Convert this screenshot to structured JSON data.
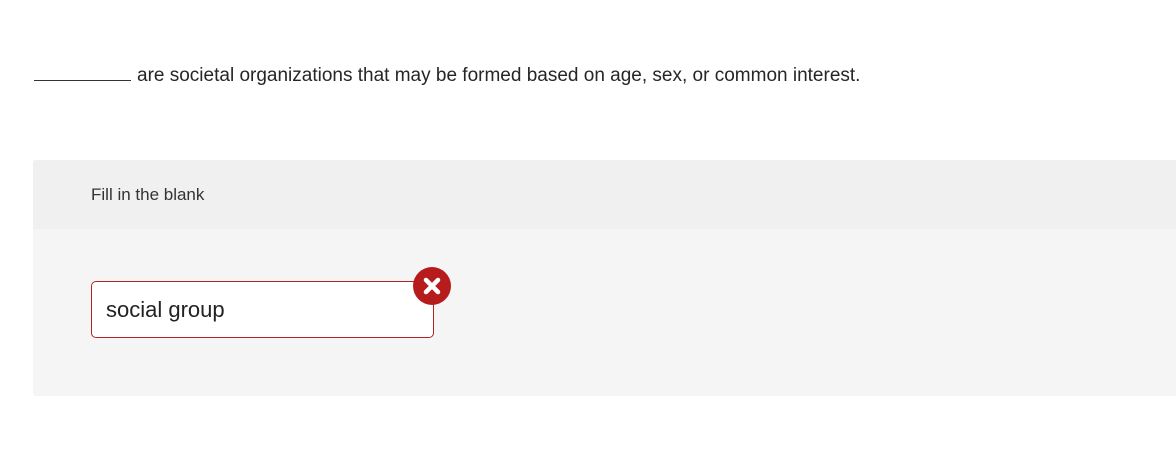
{
  "question": {
    "blank": "",
    "text": "are societal organizations that may be formed based on age, sex, or common interest."
  },
  "card": {
    "header_label": "Fill in the blank",
    "answer": {
      "value": "social group",
      "status": "incorrect",
      "status_icon": "x-circle-icon"
    }
  },
  "colors": {
    "error": "#b71c1c",
    "card_bg": "#f5f5f5",
    "card_header_bg": "#f0f0f0"
  }
}
